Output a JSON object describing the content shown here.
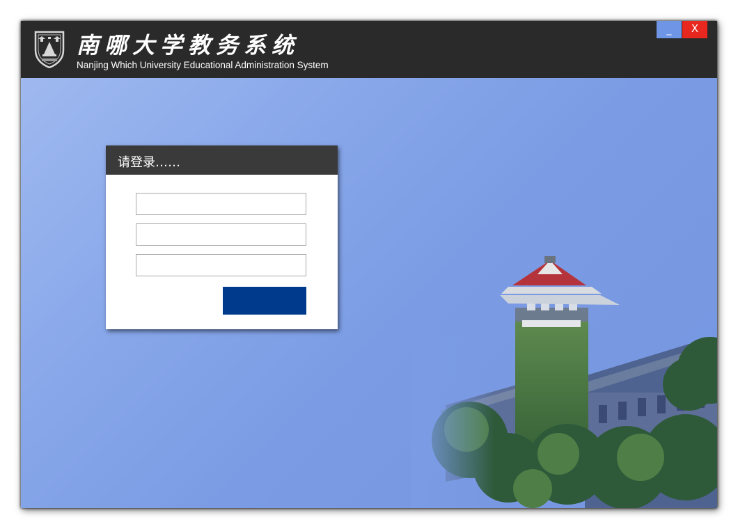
{
  "header": {
    "title_cn": "南哪大学教务系统",
    "title_en": "Nanjing Which University Educational Administration System",
    "logo_icon": "university-seal-icon"
  },
  "window_controls": {
    "minimize_label": "_",
    "close_label": "X",
    "minimize_color": "#6f95e6",
    "close_color": "#e8281f"
  },
  "login": {
    "title": "请登录……",
    "fields": [
      {
        "value": "",
        "placeholder": ""
      },
      {
        "value": "",
        "placeholder": ""
      },
      {
        "value": "",
        "placeholder": ""
      }
    ],
    "submit_label": "",
    "submit_color": "#003a8c"
  },
  "background": {
    "image": "campus-tower-photo",
    "accent": "#7f9fe3"
  }
}
